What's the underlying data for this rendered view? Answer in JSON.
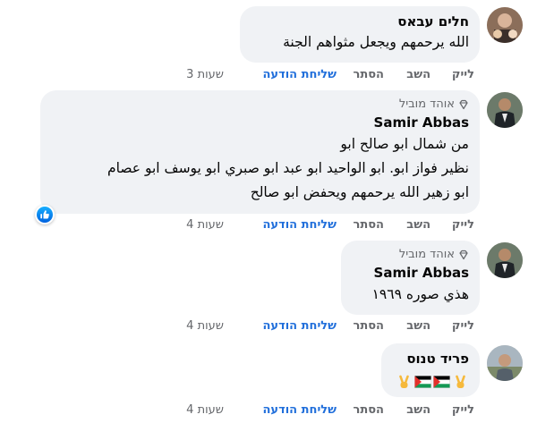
{
  "comments": [
    {
      "author": "חלים עבאס",
      "lines": [
        "الله يرحمهم ويجعل مثواهم الجنة"
      ],
      "actions": {
        "like": "לייק",
        "reply": "השב",
        "hide": "הסתר",
        "send": "שליחת הודעה",
        "time": "3 שעות"
      }
    },
    {
      "author": "אוהד מוביל",
      "badge_icon": "diamond-icon",
      "tagged": "Samir Abbas",
      "lines": [
        "من شمال ابو صالح ابو",
        "نظير فواز ابو. ابو الواحيد ابو عبد ابو صبري ابو يوسف ابو عصام",
        "ابو زهير الله يرحمهم ويحفض ابو صالح"
      ],
      "reaction": "like",
      "actions": {
        "like": "לייק",
        "reply": "השב",
        "hide": "הסתר",
        "send": "שליחת הודעה",
        "time": "4 שעות"
      }
    },
    {
      "author": "אוהד מוביל",
      "badge_icon": "diamond-icon",
      "tagged": "Samir Abbas",
      "lines": [
        "هذي صوره ١٩٦٩"
      ],
      "actions": {
        "like": "לייק",
        "reply": "השב",
        "hide": "הסתר",
        "send": "שליחת הודעה",
        "time": "4 שעות"
      }
    },
    {
      "author": "פריד טנוס",
      "emojis": [
        "victory-hand",
        "palestine-flag",
        "palestine-flag",
        "victory-hand"
      ],
      "actions": {
        "like": "לייק",
        "reply": "השב",
        "hide": "הסתר",
        "send": "שליחת הודעה",
        "time": "4 שעות"
      }
    }
  ],
  "colors": {
    "bubble": "#f0f2f5",
    "link": "#216fdb",
    "meta": "#65676b",
    "like": "#1877f2"
  }
}
